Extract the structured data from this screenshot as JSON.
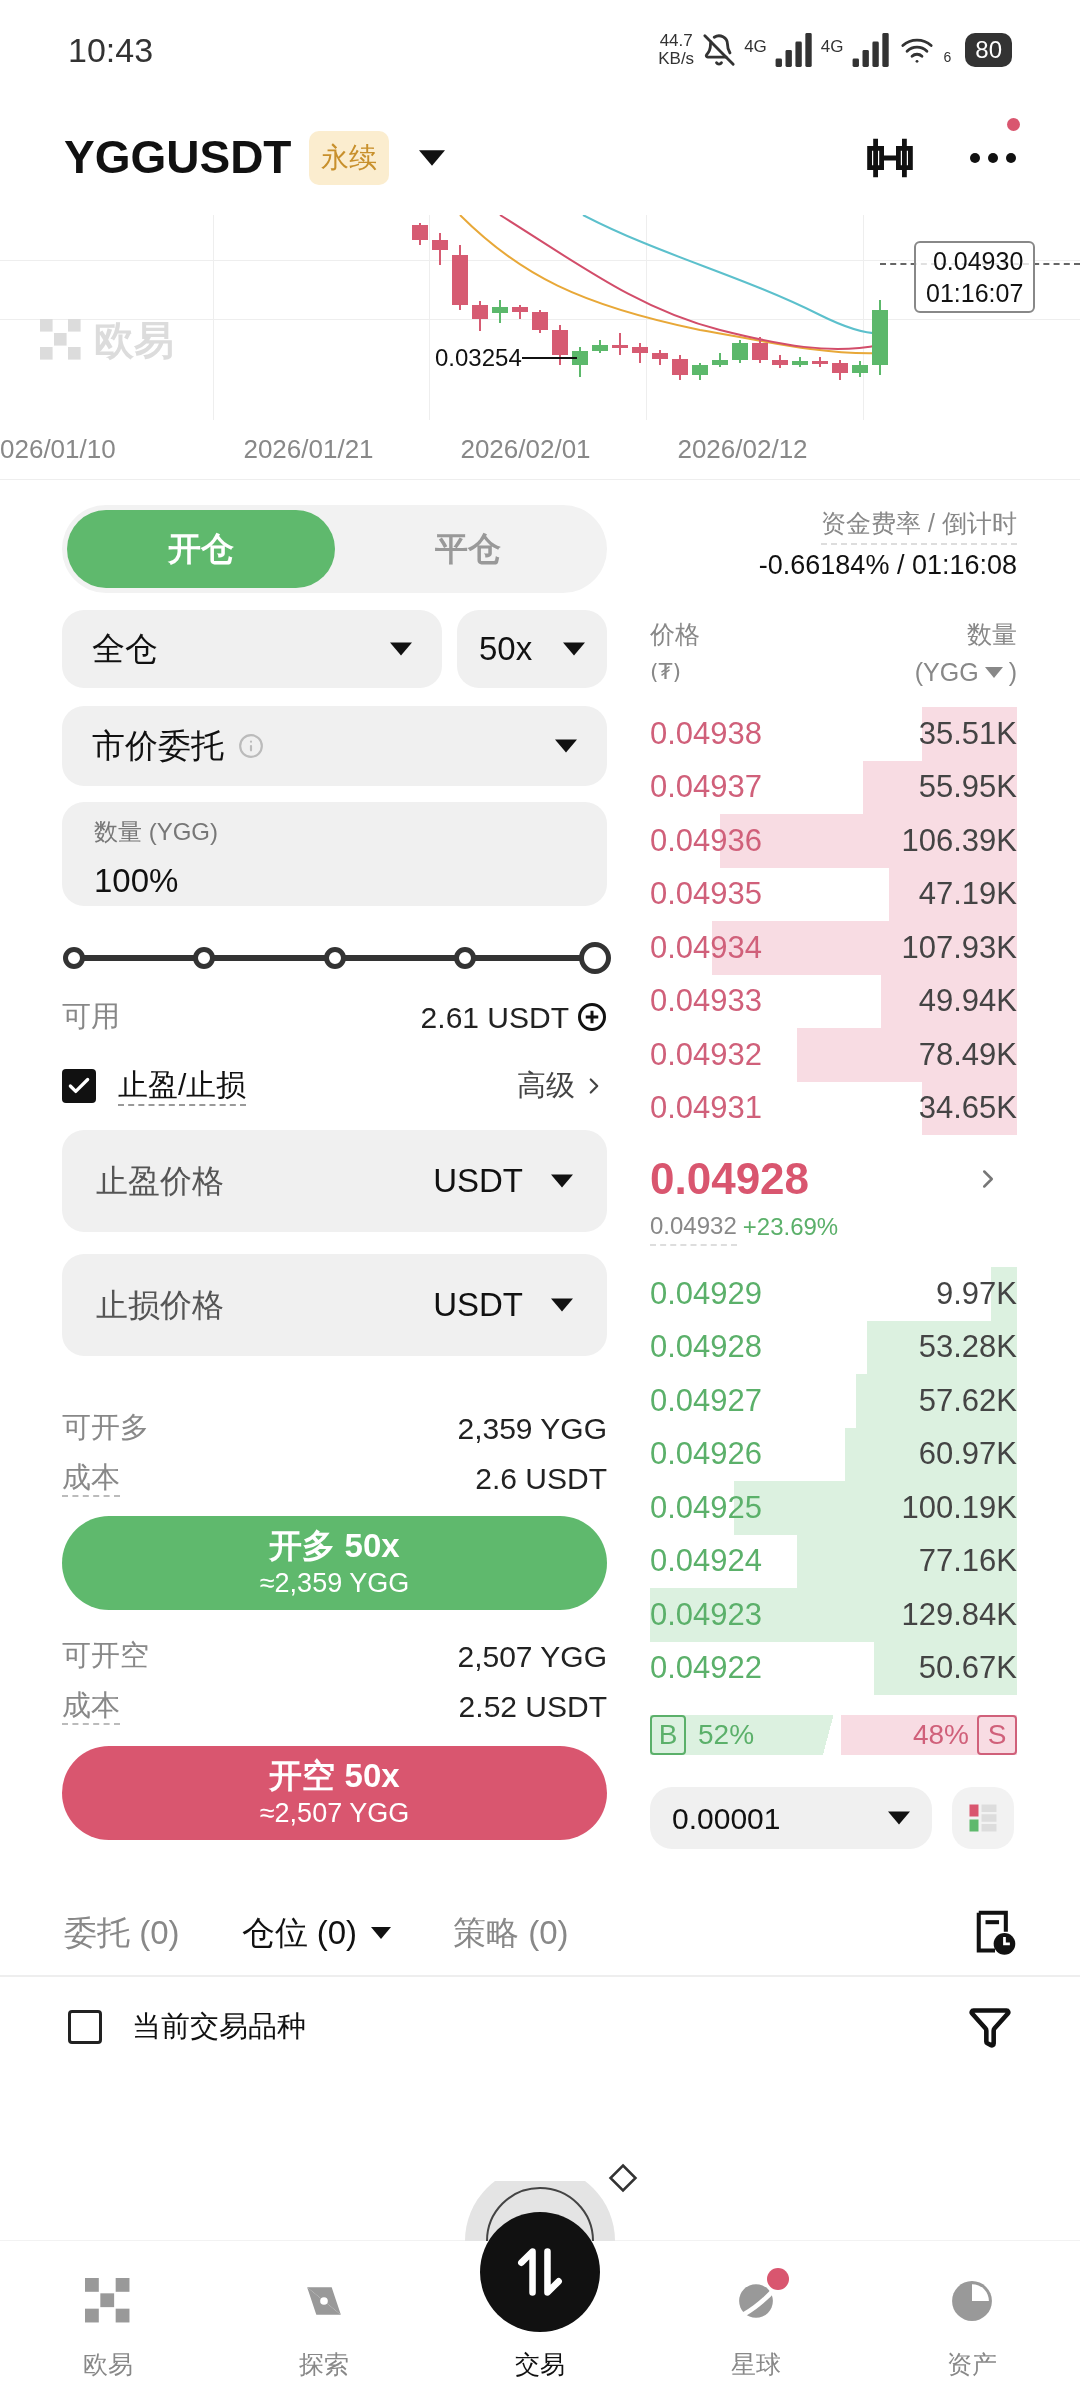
{
  "status_bar": {
    "time": "10:43",
    "net_speed": "44.7",
    "net_unit": "KB/s",
    "network_1": "4G",
    "network_2": "4G",
    "wifi_band": "6",
    "battery": "80"
  },
  "header": {
    "symbol": "YGGUSDT",
    "badge": "永续",
    "notification": true
  },
  "chart": {
    "watermark": "欧易",
    "low_label": "0.03254",
    "price_tag": "0.04930",
    "countdown": "01:16:07",
    "dates": [
      "026/01/10",
      "2026/01/21",
      "2026/02/01",
      "2026/02/12"
    ]
  },
  "position_tabs": [
    {
      "label": "开仓",
      "selected": true
    },
    {
      "label": "平仓",
      "selected": false
    }
  ],
  "margin_mode": "全仓",
  "leverage": "50x",
  "order_type": "市价委托",
  "quantity": {
    "label": "数量 (YGG)",
    "value": "100%"
  },
  "slider": {
    "level": 1
  },
  "available": {
    "label": "可用",
    "value": "2.61 USDT"
  },
  "tpsl": {
    "label": "止盈/止损",
    "checked": true,
    "advanced": "高级"
  },
  "tp_field": {
    "placeholder": "止盈价格",
    "unit": "USDT"
  },
  "sl_field": {
    "placeholder": "止损价格",
    "unit": "USDT"
  },
  "long": {
    "max_label": "可开多",
    "max_value": "2,359 YGG",
    "cost_label": "成本",
    "cost_value": "2.6 USDT",
    "button": "开多 50x",
    "button_sub": "≈2,359 YGG"
  },
  "short": {
    "max_label": "可开空",
    "max_value": "2,507 YGG",
    "cost_label": "成本",
    "cost_value": "2.52 USDT",
    "button": "开空 50x",
    "button_sub": "≈2,507 YGG"
  },
  "funding": {
    "label": "资金费率 / 倒计时",
    "value": "-0.66184% / 01:16:08"
  },
  "order_book": {
    "price_header": "价格",
    "price_unit": "(₮)",
    "qty_header": "数量",
    "qty_unit_open": "(YGG",
    "qty_unit_close": ")",
    "asks": [
      {
        "price": "0.04938",
        "qty": "35.51K",
        "level": 0.26
      },
      {
        "price": "0.04937",
        "qty": "55.95K",
        "level": 0.42
      },
      {
        "price": "0.04936",
        "qty": "106.39K",
        "level": 0.81
      },
      {
        "price": "0.04935",
        "qty": "47.19K",
        "level": 0.35
      },
      {
        "price": "0.04934",
        "qty": "107.93K",
        "level": 0.83
      },
      {
        "price": "0.04933",
        "qty": "49.94K",
        "level": 0.37
      },
      {
        "price": "0.04932",
        "qty": "78.49K",
        "level": 0.6
      },
      {
        "price": "0.04931",
        "qty": "34.65K",
        "level": 0.26
      }
    ],
    "last_price": "0.04928",
    "mark_price": "0.04932",
    "change": "+23.69%",
    "bids": [
      {
        "price": "0.04929",
        "qty": "9.97K",
        "level": 0.07
      },
      {
        "price": "0.04928",
        "qty": "53.28K",
        "level": 0.41
      },
      {
        "price": "0.04927",
        "qty": "57.62K",
        "level": 0.44
      },
      {
        "price": "0.04926",
        "qty": "60.97K",
        "level": 0.47
      },
      {
        "price": "0.04925",
        "qty": "100.19K",
        "level": 0.77
      },
      {
        "price": "0.04924",
        "qty": "77.16K",
        "level": 0.6
      },
      {
        "price": "0.04923",
        "qty": "129.84K",
        "level": 1
      },
      {
        "price": "0.04922",
        "qty": "50.67K",
        "level": 0.39
      }
    ],
    "buy": {
      "label": "B",
      "value": "52%",
      "level": 0.52
    },
    "sell": {
      "label": "S",
      "value": "48%"
    },
    "tick_size": "0.00001"
  },
  "orders_tabs": [
    {
      "label": "委托 (0)",
      "selected": false
    },
    {
      "label": "仓位 (0)",
      "selected": true
    },
    {
      "label": "策略 (0)",
      "selected": false
    }
  ],
  "filter": {
    "label": "当前交易品种",
    "checked": false
  },
  "nav": [
    {
      "label": "欧易",
      "selected": false,
      "badge": false
    },
    {
      "label": "探索",
      "selected": false,
      "badge": false
    },
    {
      "label": "交易",
      "selected": true,
      "badge": false
    },
    {
      "label": "星球",
      "selected": false,
      "badge": true
    },
    {
      "label": "资产",
      "selected": false,
      "badge": false
    }
  ]
}
